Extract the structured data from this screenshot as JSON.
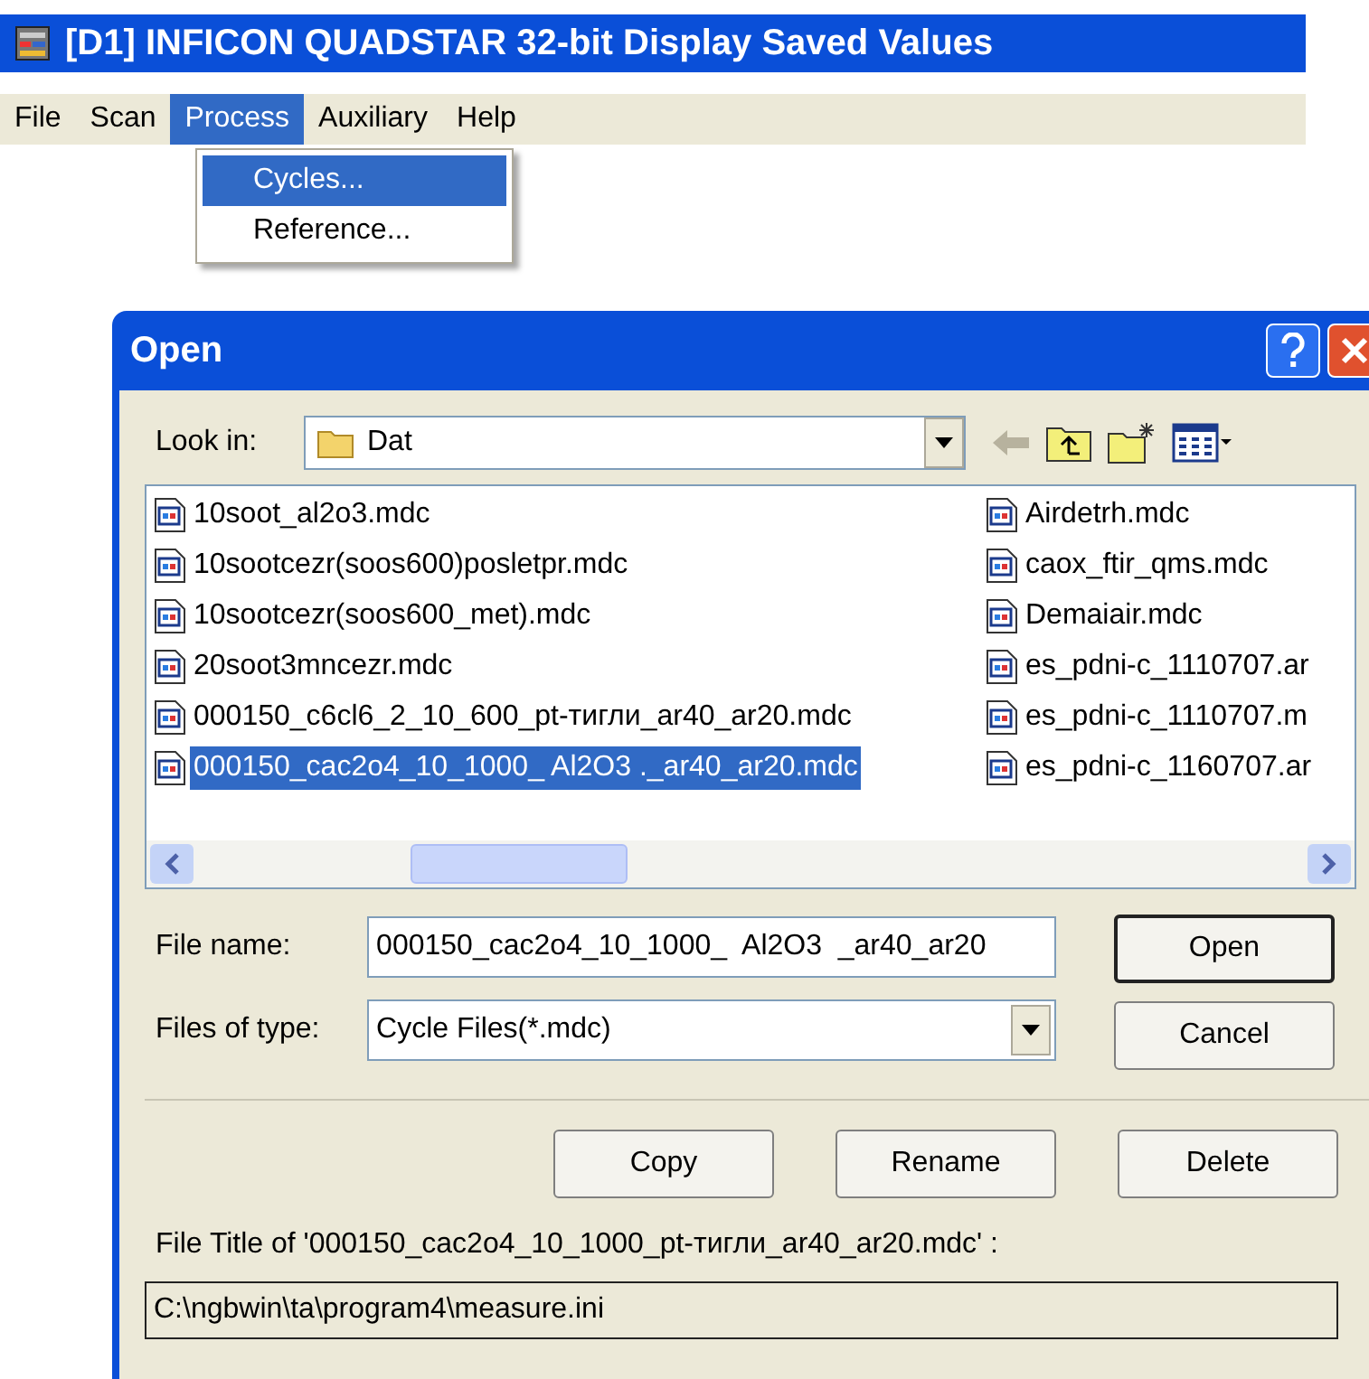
{
  "app": {
    "title": "[D1] INFICON QUADSTAR 32-bit Display Saved Values",
    "menu": [
      {
        "label": "File",
        "selected": false
      },
      {
        "label": "Scan",
        "selected": false
      },
      {
        "label": "Process",
        "selected": true
      },
      {
        "label": "Auxiliary",
        "selected": false
      },
      {
        "label": "Help",
        "selected": false
      }
    ],
    "dropdown": [
      {
        "label": "Cycles...",
        "selected": true
      },
      {
        "label": "Reference...",
        "selected": false
      }
    ]
  },
  "dialog": {
    "title": "Open",
    "look_in": {
      "label": "Look in:",
      "value": "Dat"
    },
    "file_columns": [
      [
        {
          "name": "10soot_al2o3.mdc",
          "selected": false
        },
        {
          "name": "10sootcezr(soos600)posletpr.mdc",
          "selected": false
        },
        {
          "name": "10sootcezr(soos600_met).mdc",
          "selected": false
        },
        {
          "name": "20soot3mncezr.mdc",
          "selected": false
        },
        {
          "name": "000150_c6cl6_2_10_600_pt-тигли_ar40_ar20.mdc",
          "selected": false
        },
        {
          "name": "000150_cac2o4_10_1000_  Al2O3 ._ar40_ar20.mdc",
          "selected": true
        }
      ],
      [
        {
          "name": "Airdetrh.mdc",
          "selected": false
        },
        {
          "name": "caox_ftir_qms.mdc",
          "selected": false
        },
        {
          "name": "Demaiair.mdc",
          "selected": false
        },
        {
          "name": "es_pdni-c_1110707.ar",
          "selected": false
        },
        {
          "name": "es_pdni-c_1110707.m",
          "selected": false
        },
        {
          "name": "es_pdni-c_1160707.ar",
          "selected": false
        }
      ]
    ],
    "file_name": {
      "label": "File name:",
      "value": "000150_cac2o4_10_1000_  Al2O3  _ar40_ar20"
    },
    "file_type": {
      "label": "Files of type:",
      "value": "Cycle Files(*.mdc)"
    },
    "main_buttons": [
      "Open",
      "Cancel"
    ],
    "action_buttons": [
      "Copy",
      "Rename",
      "Delete"
    ],
    "file_title_label": "File Title of '000150_cac2o4_10_1000_pt-тигли_ar40_ar20.mdc' :",
    "file_title_value": "C:\\ngbwin\\ta\\program4\\measure.ini"
  }
}
